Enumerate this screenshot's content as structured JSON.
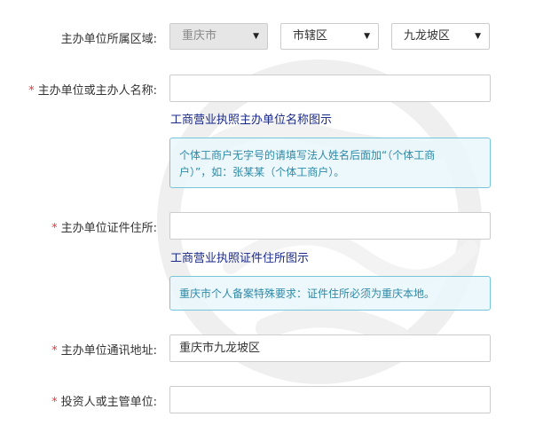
{
  "form": {
    "region": {
      "label": "主办单位所属区域:",
      "province": "重庆市",
      "city": "市辖区",
      "district": "九龙坡区"
    },
    "sponsor_name": {
      "required_mark": "*",
      "label": "主办单位或主办人名称:",
      "value": "",
      "link": "工商营业执照主办单位名称图示",
      "tip": "个体工商户无字号的请填写法人姓名后面加“（个体工商户）”，如：张某某（个体工商户）。"
    },
    "cert_address": {
      "required_mark": "*",
      "label": "主办单位证件住所:",
      "value": "",
      "link": "工商营业执照证件住所图示",
      "tip": "重庆市个人备案特殊要求：证件住所必须为重庆本地。"
    },
    "mail_address": {
      "required_mark": "*",
      "label": "主办单位通讯地址:",
      "value": "重庆市九龙坡区"
    },
    "investor": {
      "required_mark": "*",
      "label": "投资人或主管单位:",
      "value": ""
    }
  },
  "icons": {
    "caret": "▼"
  }
}
